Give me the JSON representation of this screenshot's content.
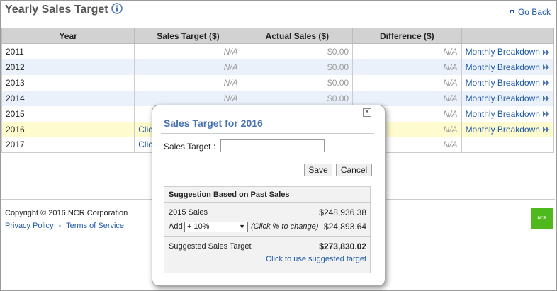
{
  "header": {
    "title": "Yearly Sales Target",
    "back_label": "Go Back"
  },
  "table": {
    "columns": [
      "Year",
      "Sales Target ($)",
      "Actual Sales ($)",
      "Difference ($)"
    ],
    "rows": [
      {
        "year": "2011",
        "target": "N/A",
        "actual": "$0.00",
        "difference": "N/A",
        "breakdown": "Monthly Breakdown"
      },
      {
        "year": "2012",
        "target": "N/A",
        "actual": "$0.00",
        "difference": "N/A",
        "breakdown": "Monthly Breakdown"
      },
      {
        "year": "2013",
        "target": "N/A",
        "actual": "$0.00",
        "difference": "N/A",
        "breakdown": "Monthly Breakdown"
      },
      {
        "year": "2014",
        "target": "N/A",
        "actual": "$0.00",
        "difference": "N/A",
        "breakdown": "Monthly Breakdown"
      },
      {
        "year": "2015",
        "target": "",
        "actual": "",
        "difference": "N/A",
        "breakdown": "Monthly Breakdown"
      },
      {
        "year": "2016",
        "target": "Clic",
        "actual": "",
        "difference": "N/A",
        "breakdown": "Monthly Breakdown"
      },
      {
        "year": "2017",
        "target": "Clic",
        "actual": "",
        "difference": "N/A",
        "breakdown": ""
      }
    ]
  },
  "footer": {
    "copyright": "Copyright © 2016 NCR Corporation",
    "privacy_label": "Privacy Policy",
    "separator": "-",
    "terms_label": "Terms of Service",
    "logo_text": "NCR"
  },
  "modal": {
    "close_glyph": "✕",
    "title": "Sales Target for 2016",
    "target_label": "Sales Target :",
    "target_value": "",
    "save_label": "Save",
    "cancel_label": "Cancel",
    "suggestion": {
      "title": "Suggestion Based on Past Sales",
      "past_label": "2015 Sales",
      "past_value": "$248,936.38",
      "add_label": "Add",
      "selected_option": "+ 10%",
      "hint": "(Click % to change)",
      "add_value": "$24,893.64",
      "suggested_label": "Suggested Sales Target",
      "suggested_value": "$273,830.02",
      "use_link": "Click to use suggested target"
    }
  },
  "colors": {
    "accent_blue": "#1f5aa6",
    "modal_title": "#4a74b0",
    "highlight_row": "#fefbcf",
    "alt_row": "#eaf1fb",
    "logo_green": "#4fb81c"
  },
  "icons": {
    "info": "info-icon",
    "back": "back-square-icon",
    "arrows": "double-chevron-right-icon",
    "close": "close-icon",
    "dropdown": "chevron-down-icon"
  }
}
